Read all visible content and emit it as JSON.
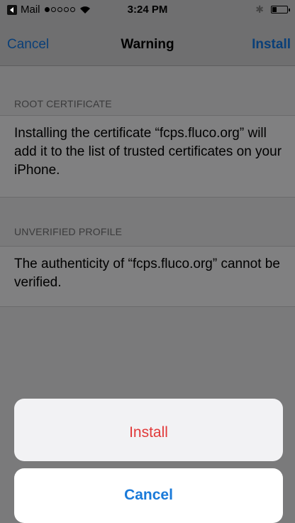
{
  "status_bar": {
    "back_app": "Mail",
    "time": "3:24 PM",
    "signal_filled": 1,
    "signal_total": 5
  },
  "nav": {
    "cancel": "Cancel",
    "title": "Warning",
    "install": "Install"
  },
  "sections": [
    {
      "header": "ROOT CERTIFICATE",
      "body": "Installing the certificate “fcps.fluco.org” will add it to the list of trusted certificates on your iPhone."
    },
    {
      "header": "UNVERIFIED PROFILE",
      "body": "The authenticity of “fcps.fluco.org” cannot be verified."
    }
  ],
  "action_sheet": {
    "install": "Install",
    "cancel": "Cancel"
  },
  "colors": {
    "destructive": "#e13a3a",
    "tint": "#1a7ad9"
  }
}
